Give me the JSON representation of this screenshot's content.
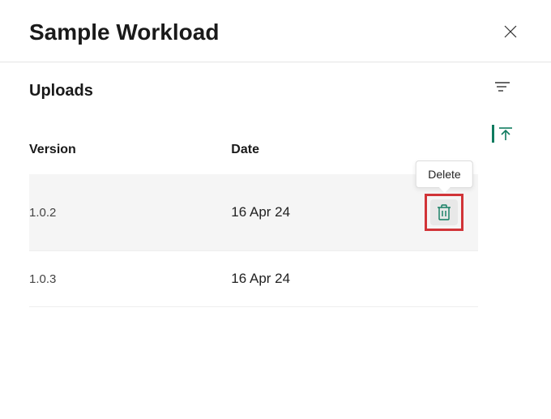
{
  "header": {
    "title": "Sample Workload"
  },
  "section": {
    "title": "Uploads"
  },
  "columns": {
    "version": "Version",
    "date": "Date"
  },
  "rows": [
    {
      "version": "1.0.2",
      "date": "16 Apr 24",
      "highlighted": true,
      "showDelete": true
    },
    {
      "version": "1.0.3",
      "date": "16 Apr 24",
      "highlighted": false,
      "showDelete": false
    }
  ],
  "tooltip": {
    "delete": "Delete"
  },
  "colors": {
    "accent": "#0f7b5f",
    "highlight_border": "#d13438"
  }
}
